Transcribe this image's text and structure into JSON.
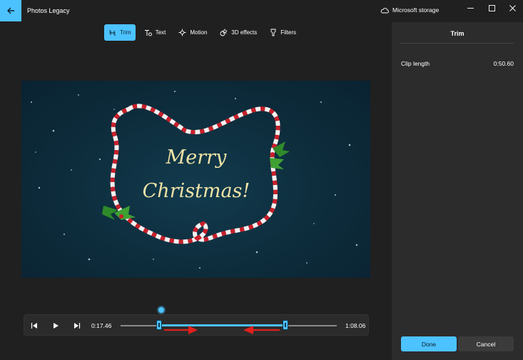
{
  "app": {
    "title": "Photos Legacy",
    "storage_label": "Microsoft storage",
    "icons": {
      "back": "back-arrow-icon",
      "storage": "cloud-icon",
      "minimize": "minimize-icon",
      "maximize": "maximize-icon",
      "close": "close-icon"
    }
  },
  "toolbar": {
    "items": [
      {
        "label": "Trim",
        "icon": "trim-icon",
        "active": true
      },
      {
        "label": "Text",
        "icon": "text-icon",
        "active": false
      },
      {
        "label": "Motion",
        "icon": "motion-icon",
        "active": false
      },
      {
        "label": "3D effects",
        "icon": "3d-effects-icon",
        "active": false
      },
      {
        "label": "Filters",
        "icon": "filters-icon",
        "active": false
      }
    ]
  },
  "preview": {
    "line1": "Merry",
    "line2": "Christmas!"
  },
  "playback": {
    "start_time": "0:17.46",
    "end_time": "1:08.06",
    "icons": {
      "prev_frame": "previous-frame-icon",
      "play": "play-icon",
      "next_frame": "next-frame-icon"
    }
  },
  "panel": {
    "title": "Trim",
    "clip_length_label": "Clip length",
    "clip_length_value": "0:50.60",
    "done_label": "Done",
    "cancel_label": "Cancel"
  },
  "colors": {
    "accent": "#4cc2ff",
    "background": "#202020",
    "panel": "#2c2c2c",
    "annotation_arrow": "#e0201b"
  }
}
